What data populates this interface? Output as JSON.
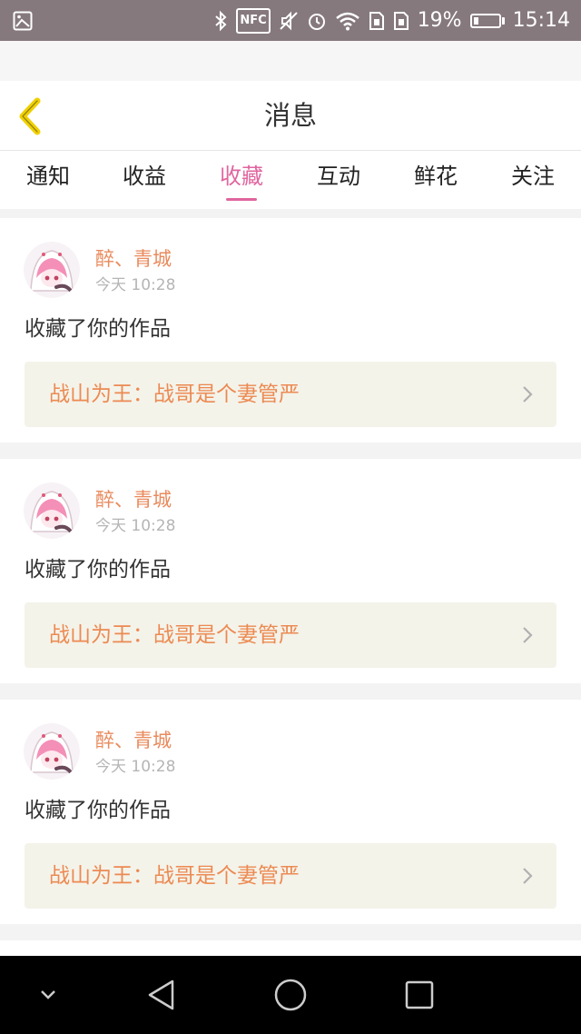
{
  "status_bar": {
    "battery_text": "19%",
    "battery_level": 0.19,
    "time": "15:14",
    "nfc_label": "NFC",
    "icons": [
      "image-icon",
      "bluetooth-icon",
      "nfc-icon",
      "mute-icon",
      "alarm-icon",
      "wifi-icon",
      "sim1-icon",
      "sim2-icon",
      "battery-icon"
    ]
  },
  "header": {
    "title": "消息",
    "back_icon": "chevron-left-icon"
  },
  "tabs": [
    {
      "label": "通知",
      "active": false
    },
    {
      "label": "收益",
      "active": false
    },
    {
      "label": "收藏",
      "active": true
    },
    {
      "label": "互动",
      "active": false
    },
    {
      "label": "鲜花",
      "active": false
    },
    {
      "label": "关注",
      "active": false
    }
  ],
  "items": [
    {
      "user": "醉、青城",
      "time": "今天 10:28",
      "action": "收藏了你的作品",
      "work_title": "战山为王：战哥是个妻管严"
    },
    {
      "user": "醉、青城",
      "time": "今天 10:28",
      "action": "收藏了你的作品",
      "work_title": "战山为王：战哥是个妻管严"
    },
    {
      "user": "醉、青城",
      "time": "今天 10:28",
      "action": "收藏了你的作品",
      "work_title": "战山为王：战哥是个妻管严"
    }
  ],
  "colors": {
    "accent_pink": "#e0659e",
    "name_orange": "#e98a5c",
    "work_orange": "#ec8a52",
    "back_arrow": "#f0d000",
    "status_bar_bg": "#86797d"
  },
  "nav_bar": {
    "buttons": [
      "hide-nav-icon",
      "back-triangle-icon",
      "home-circle-icon",
      "recents-square-icon"
    ]
  }
}
